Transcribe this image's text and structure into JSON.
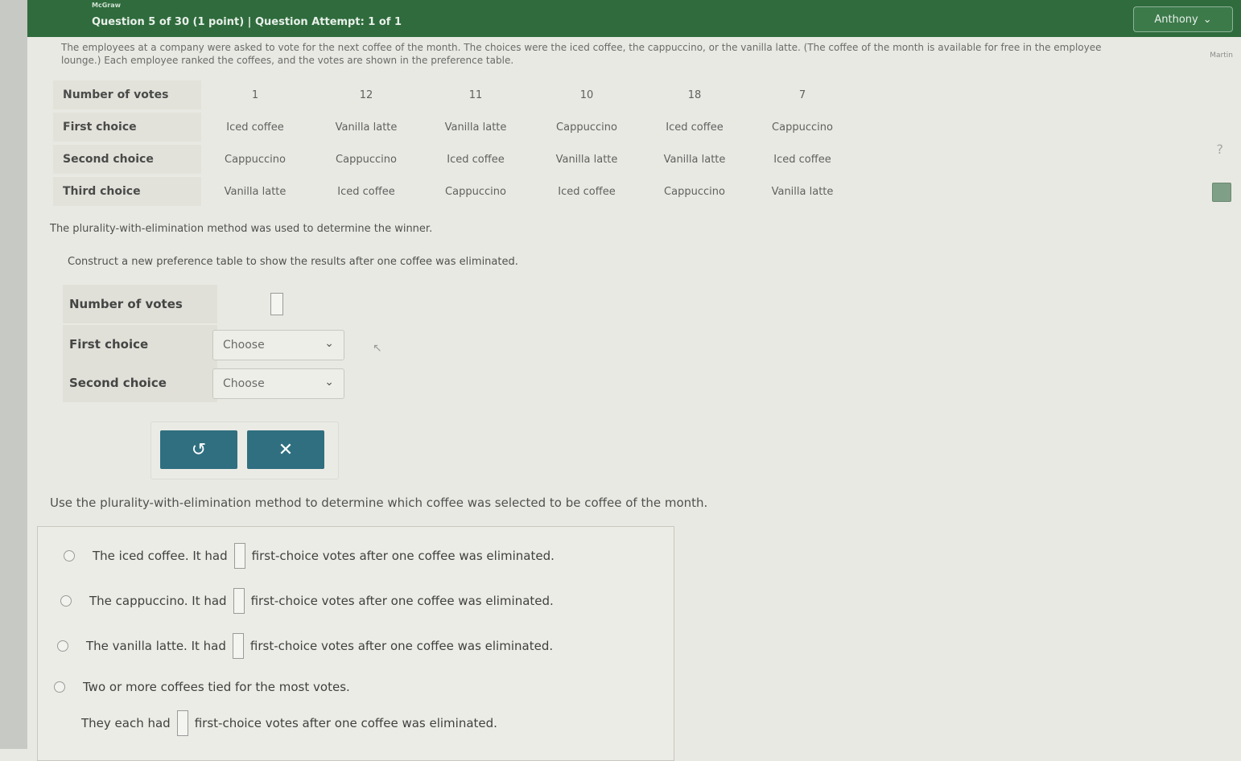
{
  "header": {
    "brand_small": "McGraw",
    "question_info": "Question 5 of 30 (1 point)  |  Question Attempt: 1 of 1",
    "user_name": "Anthony"
  },
  "side": {
    "label": "Martin",
    "help_glyph": "?"
  },
  "intro_text": "The employees at a company were asked to vote for the next coffee of the month. The choices were the iced coffee, the cappuccino, or the vanilla latte. (The coffee of the month is available for free in the employee lounge.) Each employee ranked the coffees, and the votes are shown in the preference table.",
  "preference_table": {
    "row_labels": [
      "Number of votes",
      "First choice",
      "Second choice",
      "Third choice"
    ],
    "votes": [
      "1",
      "12",
      "11",
      "10",
      "18",
      "7"
    ],
    "first": [
      "Iced coffee",
      "Vanilla latte",
      "Vanilla latte",
      "Cappuccino",
      "Iced coffee",
      "Cappuccino"
    ],
    "second": [
      "Cappuccino",
      "Cappuccino",
      "Iced coffee",
      "Vanilla latte",
      "Vanilla latte",
      "Iced coffee"
    ],
    "third": [
      "Vanilla latte",
      "Iced coffee",
      "Cappuccino",
      "Iced coffee",
      "Cappuccino",
      "Vanilla latte"
    ]
  },
  "method_text": "The plurality-with-elimination method was used to determine the winner.",
  "construct_text": "Construct a new preference table to show the results after one coffee was eliminated.",
  "new_table": {
    "labels": [
      "Number of votes",
      "First choice",
      "Second choice"
    ],
    "select_first": "Choose",
    "select_second": "Choose"
  },
  "buttons": {
    "undo_glyph": "↺",
    "clear_glyph": "✕"
  },
  "question2": "Use the plurality-with-elimination method to determine which coffee was selected to be coffee of the month.",
  "options": {
    "opt1_pre": "The iced coffee. It had",
    "opt2_pre": "The cappuccino. It had",
    "opt3_pre": "The vanilla latte. It had",
    "post": "first-choice votes after one coffee was eliminated.",
    "opt4_line1": "Two or more coffees tied for the most votes.",
    "opt4_pre": "They each had",
    "opt4_post": "first-choice votes after one coffee was eliminated."
  },
  "colors": {
    "topbar": "#2f6b3c",
    "button": "#2f6f80",
    "background": "#e9e9e3"
  }
}
